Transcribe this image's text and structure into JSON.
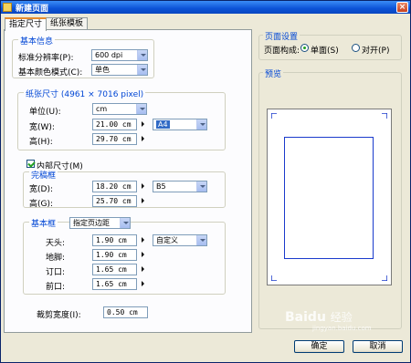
{
  "window": {
    "title": "新建页面",
    "close_glyph": "×"
  },
  "tabs": [
    {
      "label": "指定尺寸",
      "active": true
    },
    {
      "label": "纸张模板",
      "active": false
    }
  ],
  "basic_info": {
    "title": "基本信息",
    "resolution_label": "标准分辨率(P):",
    "resolution_value": "600 dpi",
    "color_mode_label": "基本颜色模式(C):",
    "color_mode_value": "单色"
  },
  "paper_size": {
    "title": "纸张尺寸 (4961 × 7016 pixel)",
    "unit_label": "单位(U):",
    "unit_value": "cm",
    "width_label": "宽(W):",
    "width_value": "21.00 cm",
    "height_label": "高(H):",
    "height_value": "29.70 cm",
    "preset_value": "A4"
  },
  "inner_size": {
    "checkbox_label": "内部尺寸(M)",
    "checked": true,
    "frame_title": "完稿框",
    "width_label": "宽(D):",
    "width_value": "18.20 cm",
    "height_label": "高(G):",
    "height_value": "25.70 cm",
    "preset_value": "B5"
  },
  "base_frame": {
    "title": "基本框",
    "mode_value": "指定页边距",
    "top_label": "天头:",
    "top_value": "1.90 cm",
    "bottom_label": "地脚:",
    "bottom_value": "1.90 cm",
    "inner_label": "订口:",
    "inner_value": "1.65 cm",
    "outer_label": "前口:",
    "outer_value": "1.65 cm",
    "preset_value": "自定义"
  },
  "bleed": {
    "label": "裁剪宽度(I):",
    "value": "0.50 cm"
  },
  "page_settings": {
    "title": "页面设置",
    "layout_label": "页面构成:",
    "single_label": "单面(S)",
    "double_label": "对开(P)",
    "selected": "single"
  },
  "preview": {
    "title": "预览"
  },
  "buttons": {
    "ok": "确定",
    "cancel": "取消"
  },
  "watermark": {
    "brand": "Baidu",
    "sub": "经验",
    "url": "jingyan.baidu.com"
  }
}
